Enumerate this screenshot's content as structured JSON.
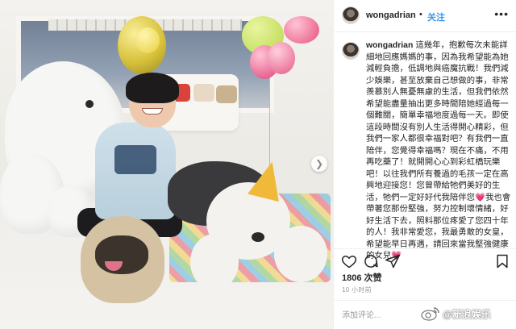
{
  "header": {
    "username": "wongadrian",
    "separator": "•",
    "follow_label": "关注",
    "more_icon": "more-horizontal-icon"
  },
  "caption": {
    "username": "wongadrian",
    "text": "這幾年，抱歉每次未能詳細地回應媽媽的事，因為我希望能為她減輕負擔，低調地與癌魔抗戰！我們減少娛樂，甚至放棄自己想做的事，非常羨慕別人無憂無慮的生活，但我們依然希望能盡量抽出更多時間陪她經過每一個難關，簡單幸福地度過每一天。即使這段時間沒有別人生活得開心精彩，但我們一家人都很幸福對吧？有我們一直陪伴，您覺得幸福嗎？現在不痛，不用再吃藥了！就開開心心到彩虹橋玩樂吧！以往我們所有養過的毛孩一定在高興地迎接您！您曾帶給牠們美好的生活，牠們一定好好代我陪伴您💗我也會帶著您那份堅強，努力控制壞情緒，好好生活下去，照料那位疼愛了您四十年的人！我非常愛您，我最勇敢的女皇，希望能早日再遇，請回來當我堅強健康的女兒💗"
  },
  "actions": {
    "like_icon": "heart-icon",
    "comment_icon": "comment-icon",
    "share_icon": "share-icon",
    "save_icon": "bookmark-icon"
  },
  "likes": "1806 次赞",
  "timestamp": "10 小时前",
  "comment": {
    "placeholder": "添加评论..."
  },
  "watermark": {
    "text": "@新浪娱乐",
    "logo_icon": "weibo-logo-icon"
  },
  "photo": {
    "next_icon": "chevron-right-icon",
    "alt": "woman with two sheepdogs and a pug"
  },
  "colors": {
    "follow": "#3897f0",
    "text": "#262626",
    "muted": "#999999",
    "border": "#efefef"
  }
}
